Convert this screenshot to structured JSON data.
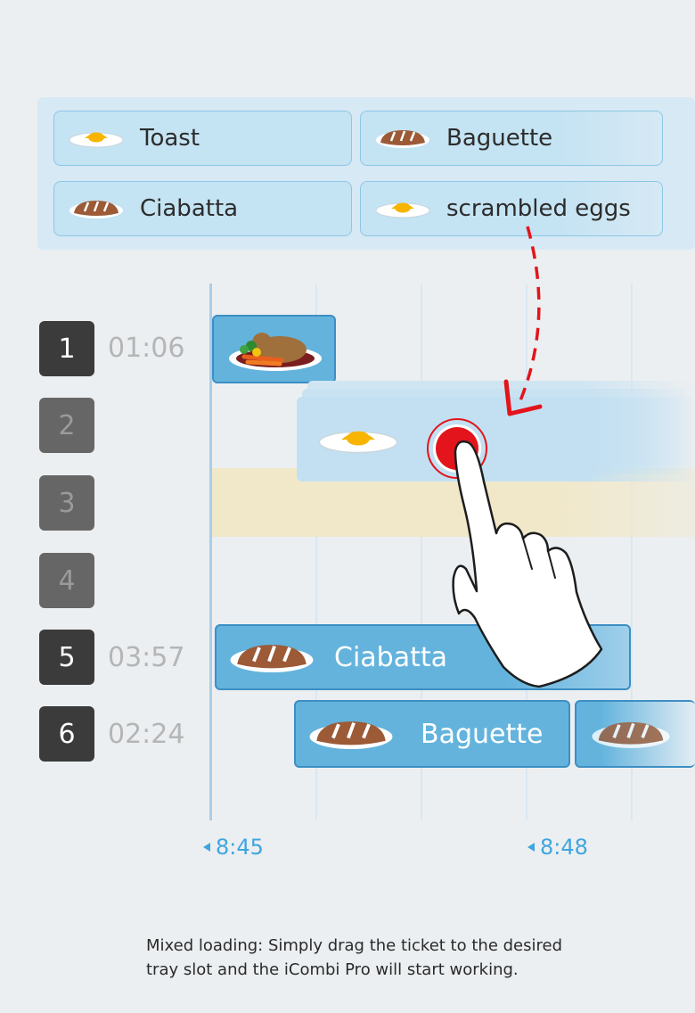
{
  "tickets": [
    {
      "label": "Toast",
      "icon": "egg-icon"
    },
    {
      "label": "Baguette",
      "icon": "bread-icon"
    },
    {
      "label": "Ciabatta",
      "icon": "bread-icon"
    },
    {
      "label": "scrambled eggs",
      "icon": "egg-icon"
    }
  ],
  "slots": [
    {
      "number": "1",
      "timer": "01:06"
    },
    {
      "number": "2",
      "timer": ""
    },
    {
      "number": "3",
      "timer": ""
    },
    {
      "number": "4",
      "timer": ""
    },
    {
      "number": "5",
      "timer": "03:57"
    },
    {
      "number": "6",
      "timer": "02:24"
    }
  ],
  "bars": {
    "slot1_icon": "roast-chicken-icon",
    "slot5_label": "Ciabatta",
    "slot6_label": "Baguette"
  },
  "time_markers": [
    "8:45",
    "8:48"
  ],
  "caption": {
    "line1": "Mixed loading: Simply drag the ticket to the desired",
    "line2": "tray slot and the iCombi Pro will start working."
  },
  "colors": {
    "accent_blue": "#63b3dd",
    "drag_arrow_red": "#e3141b",
    "highlight_slot": "#f1e8c9"
  }
}
